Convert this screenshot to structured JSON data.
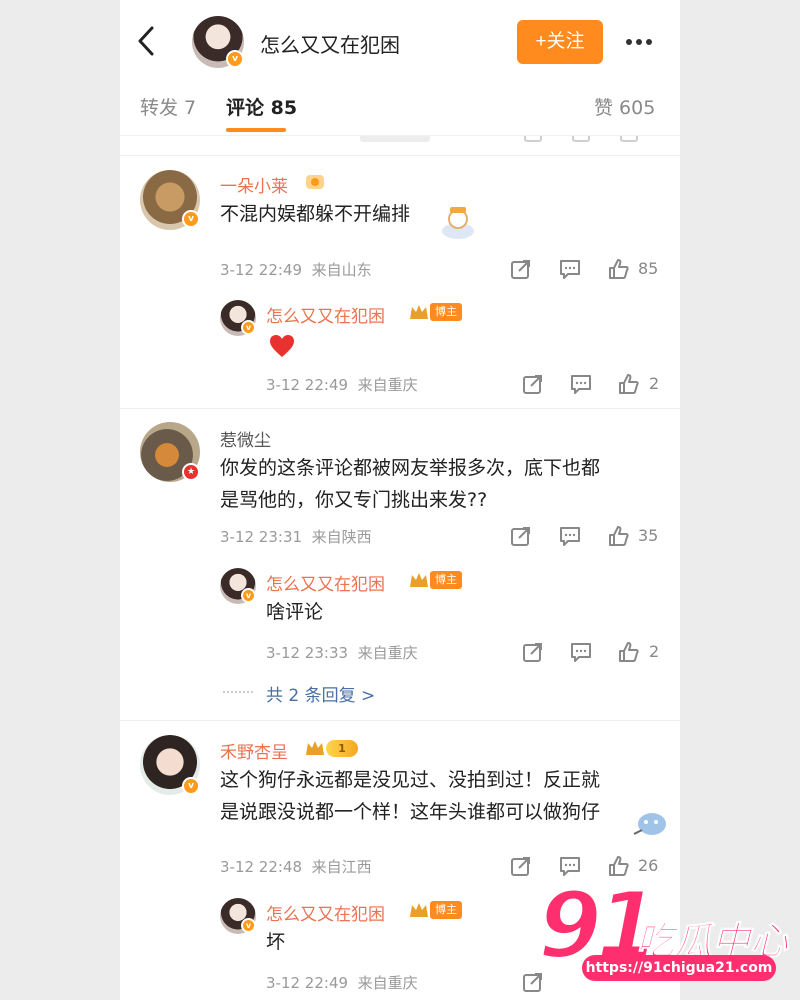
{
  "header": {
    "title": "怎么又又在犯困",
    "follow_label": "+关注"
  },
  "tabs": {
    "repost": "转发 7",
    "comments": "评论 85",
    "likes": "赞 605"
  },
  "comments": [
    {
      "user": "一朵小莱",
      "text": "不混内娱都躲不开编排",
      "date": "3-12 22:49",
      "location": "来自山东",
      "likes": "85",
      "replies": [
        {
          "user": "怎么又又在犯困",
          "badge": "博主",
          "text": "",
          "emoji": "heart",
          "date": "3-12 22:49",
          "location": "来自重庆",
          "likes": "2"
        }
      ]
    },
    {
      "user": "惹微尘",
      "text_line1": "你发的这条评论都被网友举报多次，底下也都",
      "text_line2": "是骂他的，你又专门挑出来发??",
      "date": "3-12 23:31",
      "location": "来自陕西",
      "likes": "35",
      "replies": [
        {
          "user": "怎么又又在犯困",
          "badge": "博主",
          "text": "啥评论",
          "date": "3-12 23:33",
          "location": "来自重庆",
          "likes": "2"
        }
      ],
      "more_replies": "共 2 条回复 >"
    },
    {
      "user": "禾野杏呈",
      "level": "1",
      "text_line1": "这个狗仔永远都是没见过、没拍到过！反正就",
      "text_line2": "是说跟没说都一个样！这年头谁都可以做狗仔",
      "date": "3-12 22:48",
      "location": "来自江西",
      "likes": "26",
      "replies": [
        {
          "user": "怎么又又在犯困",
          "badge": "博主",
          "text": "坏",
          "date": "3-12 22:49",
          "location": "来自重庆",
          "likes": ""
        }
      ]
    }
  ],
  "watermark": {
    "number": "91",
    "name": "吃瓜中心",
    "url": "https://91chigua21.com"
  },
  "colors": {
    "accent": "#ff8a1e",
    "username": "#eb7350",
    "link": "#4a6fa5",
    "watermark": "#ff2e6e"
  }
}
